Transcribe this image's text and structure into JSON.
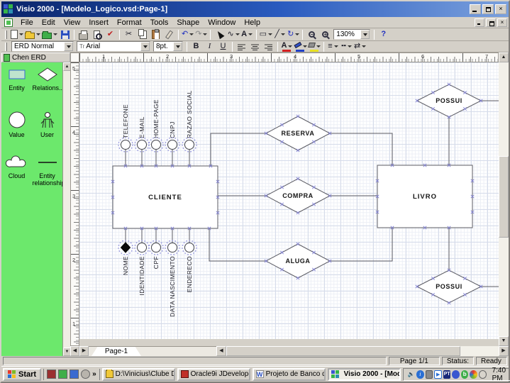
{
  "window": {
    "title": "Visio 2000 - [Modelo_Logico.vsd:Page-1]"
  },
  "menu": {
    "items": [
      "File",
      "Edit",
      "View",
      "Insert",
      "Format",
      "Tools",
      "Shape",
      "Window",
      "Help"
    ]
  },
  "toolbars": {
    "zoom_value": "130%",
    "style_value": "ERD Normal",
    "font_value": "Arial",
    "size_value": "8pt.",
    "bold": "B",
    "italic": "I",
    "underline": "U",
    "font_color": "A"
  },
  "icons": {
    "scissors": "✂",
    "spell": "✔",
    "undo": "↶",
    "redo": "↷",
    "rotate": "↻",
    "text_tool": "A",
    "rect_tool": "▭",
    "line_tool": "╱",
    "connector_tool": "∿",
    "zoom_out": "−",
    "zoom_in": "+",
    "help": "?",
    "line_weight": "≡",
    "line_pattern": "╍",
    "line_ends": "⇄",
    "truetype": "Tr",
    "up": "▲",
    "down": "▼",
    "left": "◀",
    "right": "▶",
    "chevron": "»",
    "close": "×",
    "info": "i",
    "icq": "b",
    "media": "▶"
  },
  "stencil": {
    "title": "Chen ERD",
    "items": [
      "Entity",
      "Relations...",
      "Value",
      "User",
      "Cloud",
      "Entity relationship"
    ]
  },
  "diagram": {
    "entities": {
      "cliente": "CLIENTE",
      "livro": "LIVRO"
    },
    "relationships": {
      "reserva": "RESERVA",
      "compra": "COMPRA",
      "aluga": "ALUGA",
      "possui_top": "POSSUI",
      "possui_bottom": "POSSUI"
    },
    "attributes_top": [
      "TELEFONE",
      "E-MAIL",
      "HOME-PAGE",
      "CNPJ",
      "RAZAO SOCIAL"
    ],
    "attributes_bottom": [
      "NOME",
      "IDENTIDADE",
      "CPF",
      "DATA NASCIMENTO",
      "ENDERECO"
    ]
  },
  "rulers": {
    "horizontal": [
      "1",
      "2",
      "3",
      "4",
      "5",
      "6",
      "7"
    ],
    "vertical": [
      "5",
      "4",
      "3",
      "2",
      "1"
    ]
  },
  "sheet": {
    "tab": "Page-1"
  },
  "status": {
    "page": "Page 1/1",
    "label": "Status:",
    "value": "Ready"
  },
  "taskbar": {
    "start": "Start",
    "tasks": [
      "D:\\Vinicius\\Clube Delp...",
      "Oracle9i JDeveloper - ...",
      "Projeto de Banco de D...",
      "Visio 2000 - [Model..."
    ],
    "language": "PT",
    "time": "7:40 PM"
  },
  "colors": {
    "stencil_green": "#6ce86c",
    "title_blue": "#0a246a",
    "marker": "#8080d2"
  }
}
